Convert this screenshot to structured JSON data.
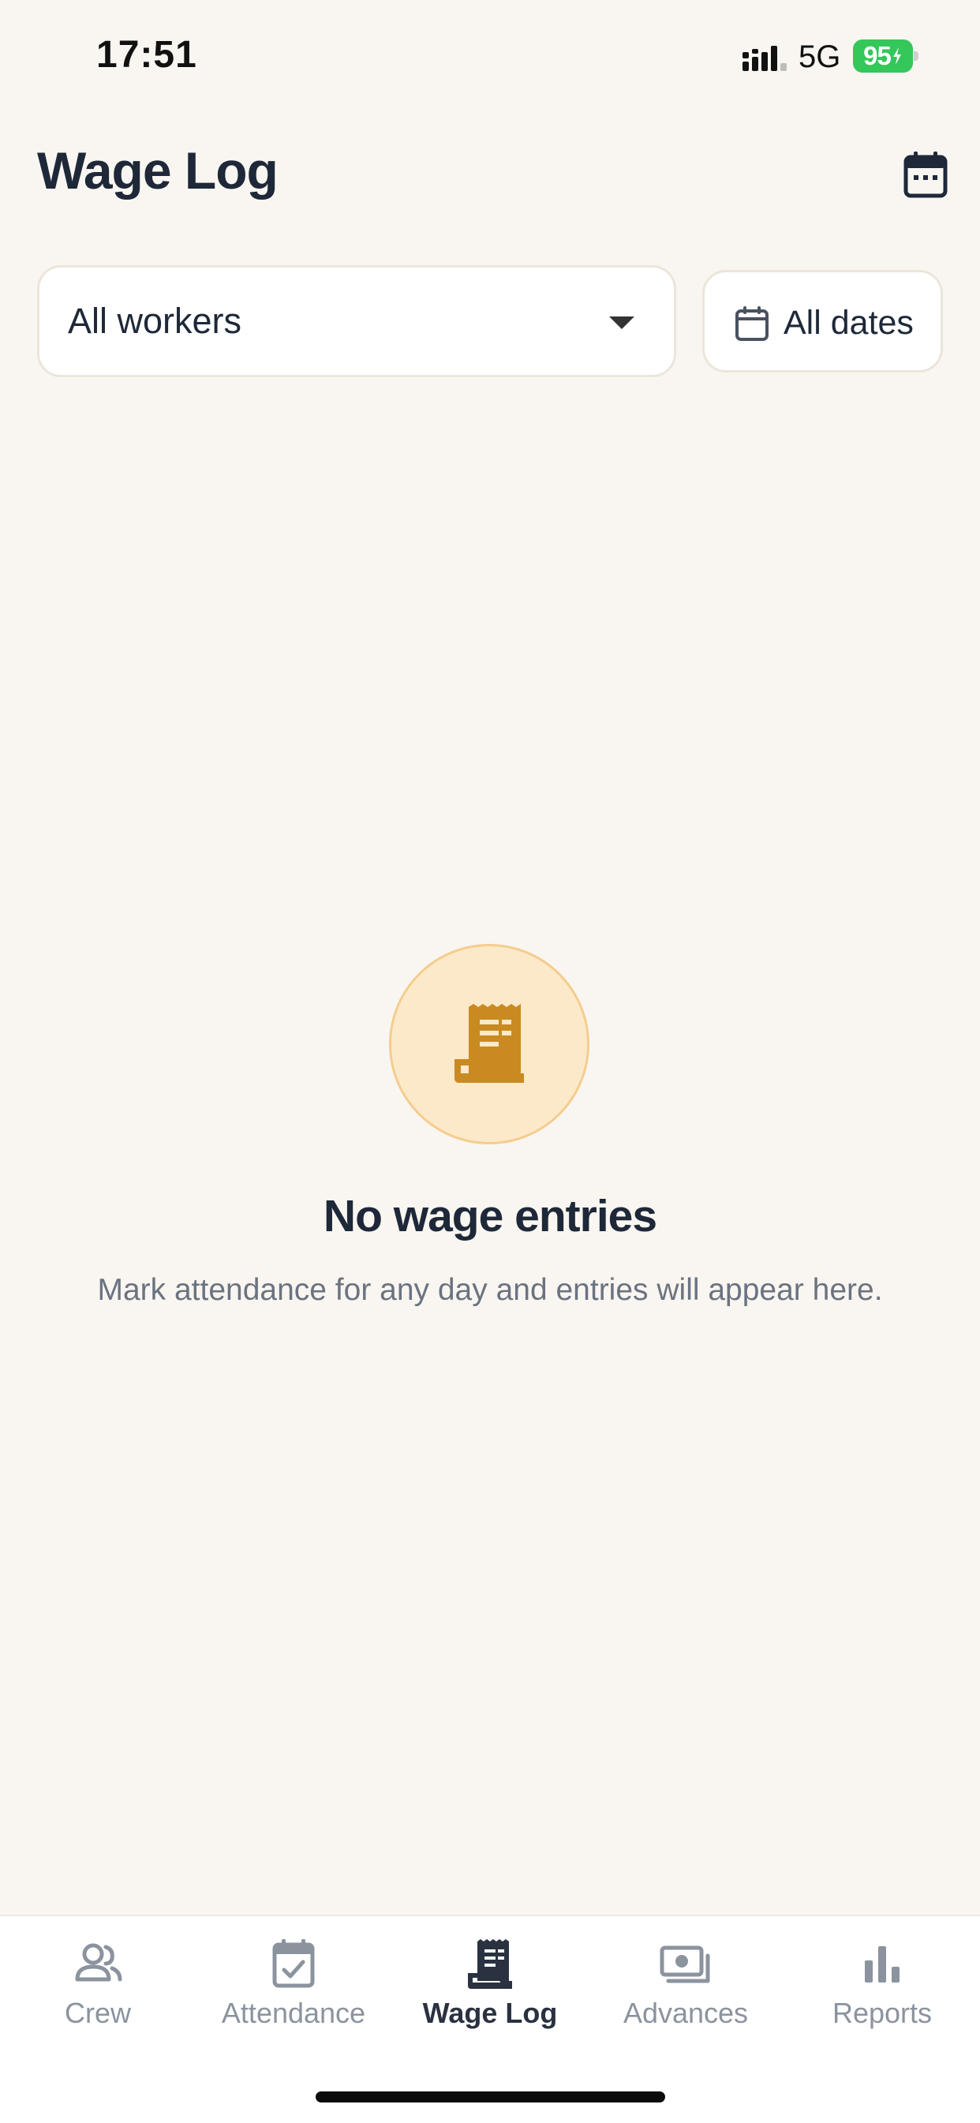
{
  "status_bar": {
    "time": "17:51",
    "network": "5G",
    "battery": "95"
  },
  "header": {
    "title": "Wage Log",
    "calendar_icon": "calendar-icon"
  },
  "filters": {
    "worker_select": {
      "value": "All workers",
      "icon": "caret-down-icon"
    },
    "date_filter": {
      "label": "All dates",
      "icon": "calendar-icon"
    }
  },
  "empty_state": {
    "icon": "receipt-icon",
    "title": "No wage entries",
    "message": "Mark attendance for any day and entries will appear here."
  },
  "bottom_nav": {
    "items": [
      {
        "label": "Crew",
        "icon": "people-icon",
        "active": false
      },
      {
        "label": "Attendance",
        "icon": "calendar-check-icon",
        "active": false
      },
      {
        "label": "Wage Log",
        "icon": "receipt-icon",
        "active": true
      },
      {
        "label": "Advances",
        "icon": "cash-icon",
        "active": false
      },
      {
        "label": "Reports",
        "icon": "bar-chart-icon",
        "active": false
      }
    ]
  },
  "colors": {
    "background": "#f9f6f1",
    "text_primary": "#1e2838",
    "text_muted": "#6b7380",
    "accent": "#c98a22",
    "accent_bg": "#fce9c9",
    "nav_inactive": "#8b939e",
    "battery": "#34c759"
  }
}
